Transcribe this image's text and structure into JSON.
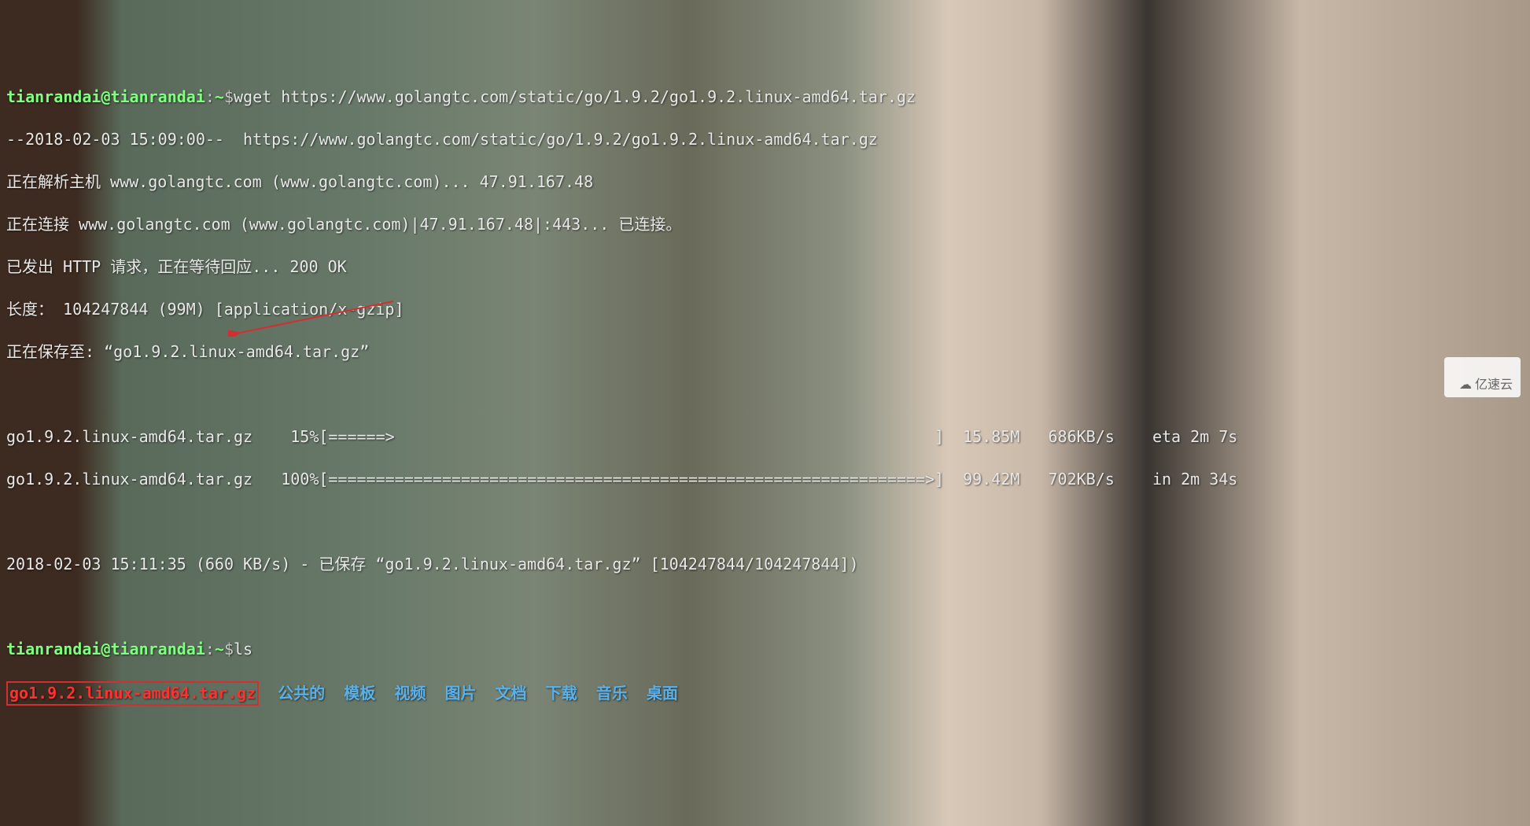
{
  "terminal": {
    "prompt1_user": "tianrandai@tianrandai",
    "prompt1_sep": ":",
    "prompt1_path": "~",
    "prompt1_dollar": "$",
    "cmd1": "wget https://www.golangtc.com/static/go/1.9.2/go1.9.2.linux-amd64.tar.gz",
    "line2": "--2018-02-03 15:09:00--  https://www.golangtc.com/static/go/1.9.2/go1.9.2.linux-amd64.tar.gz",
    "line3": "正在解析主机 www.golangtc.com (www.golangtc.com)... 47.91.167.48",
    "line4": "正在连接 www.golangtc.com (www.golangtc.com)|47.91.167.48|:443... 已连接。",
    "line5": "已发出 HTTP 请求，正在等待回应... 200 OK",
    "line6": "长度： 104247844 (99M) [application/x-gzip]",
    "line7": "正在保存至: “go1.9.2.linux-amd64.tar.gz”",
    "blank": " ",
    "progress1": "go1.9.2.linux-amd64.tar.gz    15%[======>                                                         ]  15.85M   686KB/s    eta 2m 7s",
    "progress2": "go1.9.2.linux-amd64.tar.gz   100%[===============================================================>]  99.42M   702KB/s    in 2m 34s",
    "line_saved": "2018-02-03 15:11:35 (660 KB/s) - 已保存 “go1.9.2.linux-amd64.tar.gz” [104247844/104247844])",
    "prompt2_user": "tianrandai@tianrandai",
    "prompt2_sep": ":",
    "prompt2_path": "~",
    "prompt2_dollar": "$",
    "cmd2": "ls",
    "ls_file": "go1.9.2.linux-amd64.tar.gz",
    "ls_dirs": {
      "d1": "公共的",
      "d2": "模板",
      "d3": "视频",
      "d4": "图片",
      "d5": "文档",
      "d6": "下载",
      "d7": "音乐",
      "d8": "桌面"
    }
  },
  "watermark": {
    "text": "亿速云"
  }
}
